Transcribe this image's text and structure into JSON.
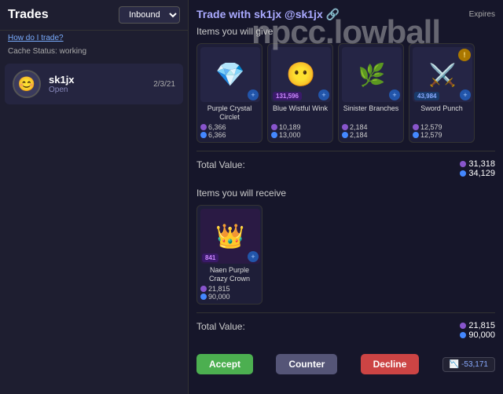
{
  "left_panel": {
    "title": "Trades",
    "dropdown_label": "Inbound",
    "how_to_trade": "How do I trade?",
    "cache_status": "Cache Status: working",
    "trade_items": [
      {
        "user": "sk1jx",
        "status": "Open",
        "time": "2/3/21",
        "avatar_emoji": "😊"
      }
    ]
  },
  "right_panel": {
    "title": "Trade with",
    "username": "sk1jx @sk1jx",
    "username_icon": "🔗",
    "expires_label": "Expires",
    "give_section_title": "Items you will give",
    "receive_section_title": "Items you will receive",
    "give_items": [
      {
        "name": "Purple Crystal Circlet",
        "badge": "",
        "badge_label": "",
        "val_purple": "6,366",
        "val_blue": "6,366",
        "art": "💎",
        "art_class": "art-crystal",
        "has_warn": false
      },
      {
        "name": "Blue Wistful Wink",
        "badge": "131,596",
        "badge_label": "131,596",
        "val_purple": "10,189",
        "val_blue": "13,000",
        "art": "😶",
        "art_class": "art-face",
        "has_warn": false
      },
      {
        "name": "Sinister Branches",
        "badge": "",
        "badge_label": "",
        "val_purple": "2,184",
        "val_blue": "2,184",
        "art": "🌿",
        "art_class": "art-branch",
        "has_warn": false
      },
      {
        "name": "Sword Punch",
        "badge": "43,984",
        "badge_label": "43,984",
        "val_purple": "12,579",
        "val_blue": "12,579",
        "art": "⚔",
        "art_class": "art-sword",
        "has_warn": true
      }
    ],
    "give_total": {
      "label": "Total Value:",
      "val_purple": "31,318",
      "val_blue": "34,129"
    },
    "receive_items": [
      {
        "name": "Naen Purple Crazy Crown",
        "badge": "841",
        "badge_label": "841",
        "val_purple": "21,815",
        "val_blue": "90,000",
        "art": "👑",
        "art_class": "art-crown",
        "has_warn": false
      }
    ],
    "receive_total": {
      "label": "Total Value:",
      "val_purple": "21,815",
      "val_blue": "90,000"
    },
    "buttons": {
      "accept": "Accept",
      "counter": "Counter",
      "decline": "Decline"
    },
    "profit_label": "-53,171"
  },
  "watermark": "npcc.lowball"
}
